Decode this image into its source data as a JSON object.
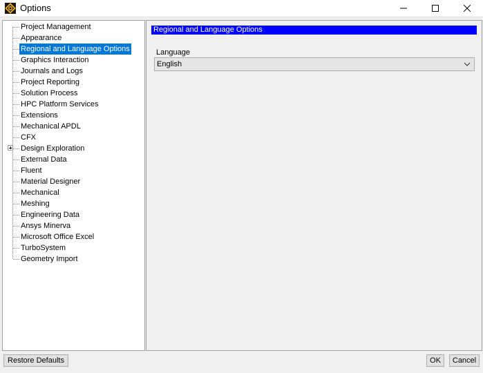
{
  "window": {
    "title": "Options",
    "minimize_icon": "minimize-icon",
    "maximize_icon": "maximize-icon",
    "close_icon": "close-icon"
  },
  "tree": {
    "items": [
      {
        "label": "Project Management"
      },
      {
        "label": "Appearance"
      },
      {
        "label": "Regional and Language Options",
        "selected": true
      },
      {
        "label": "Graphics Interaction"
      },
      {
        "label": "Journals and Logs"
      },
      {
        "label": "Project Reporting"
      },
      {
        "label": "Solution Process"
      },
      {
        "label": "HPC Platform Services"
      },
      {
        "label": "Extensions"
      },
      {
        "label": "Mechanical APDL"
      },
      {
        "label": "CFX"
      },
      {
        "label": "Design Exploration",
        "expandable": true
      },
      {
        "label": "External Data"
      },
      {
        "label": "Fluent"
      },
      {
        "label": "Material Designer"
      },
      {
        "label": "Mechanical"
      },
      {
        "label": "Meshing"
      },
      {
        "label": "Engineering Data"
      },
      {
        "label": "Ansys Minerva"
      },
      {
        "label": "Microsoft Office Excel"
      },
      {
        "label": "TurboSystem"
      },
      {
        "label": "Geometry Import"
      }
    ]
  },
  "panel": {
    "header": "Regional and Language Options",
    "language_label": "Language",
    "language_value": "English"
  },
  "buttons": {
    "restore_defaults": "Restore Defaults",
    "ok": "OK",
    "cancel": "Cancel"
  },
  "colors": {
    "selection": "#0078d7",
    "header_bg": "#0000ff"
  }
}
